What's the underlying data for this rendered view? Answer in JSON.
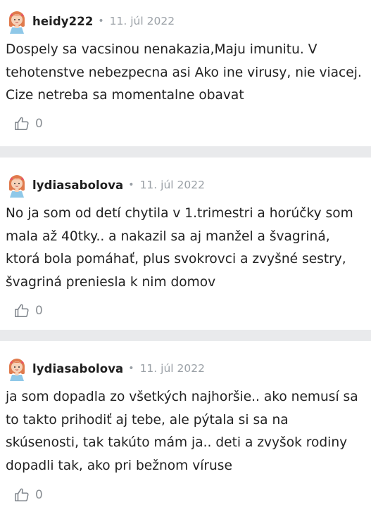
{
  "posts": [
    {
      "username": "heidy222",
      "separator_dot": "•",
      "date": "11. júl 2022",
      "text": "Dospely sa vacsinou nenakazia,Maju imunitu. V tehotenstve nebezpecna asi Ako ine virusy, nie viacej. Cize netreba sa momentalne obavat",
      "likes": "0",
      "avatar_icon": "girl-avatar-icon",
      "like_icon": "thumbs-up-outline-icon"
    },
    {
      "username": "lydiasabolova",
      "separator_dot": "•",
      "date": "11. júl 2022",
      "text": "No ja som od detí chytila v 1.trimestri a horúčky som mala až 40tky.. a nakazil sa aj manžel a švagriná, ktorá bola pomáhať, plus svokrovci a zvyšné sestry, švagriná preniesla k nim domov",
      "likes": "0",
      "avatar_icon": "girl-avatar-icon",
      "like_icon": "thumbs-up-outline-icon"
    },
    {
      "username": "lydiasabolova",
      "separator_dot": "•",
      "date": "11. júl 2022",
      "text": "ja som dopadla zo všetkých najhoršie.. ako nemusí sa to takto prihodiť aj tebe, ale pýtala si sa na skúsenosti, tak takúto mám ja.. deti a zvyšok rodiny dopadli tak, ako pri bežnom víruse",
      "likes": "0",
      "avatar_icon": "girl-avatar-icon",
      "like_icon": "thumbs-up-outline-icon"
    }
  ],
  "colors": {
    "separator": "#e9eaec",
    "meta_text": "#9aa0a6",
    "body_text": "#222222",
    "avatar_hair": "#e07a4c",
    "avatar_bow": "#e94c6b",
    "avatar_dress": "#8fc8e8"
  }
}
